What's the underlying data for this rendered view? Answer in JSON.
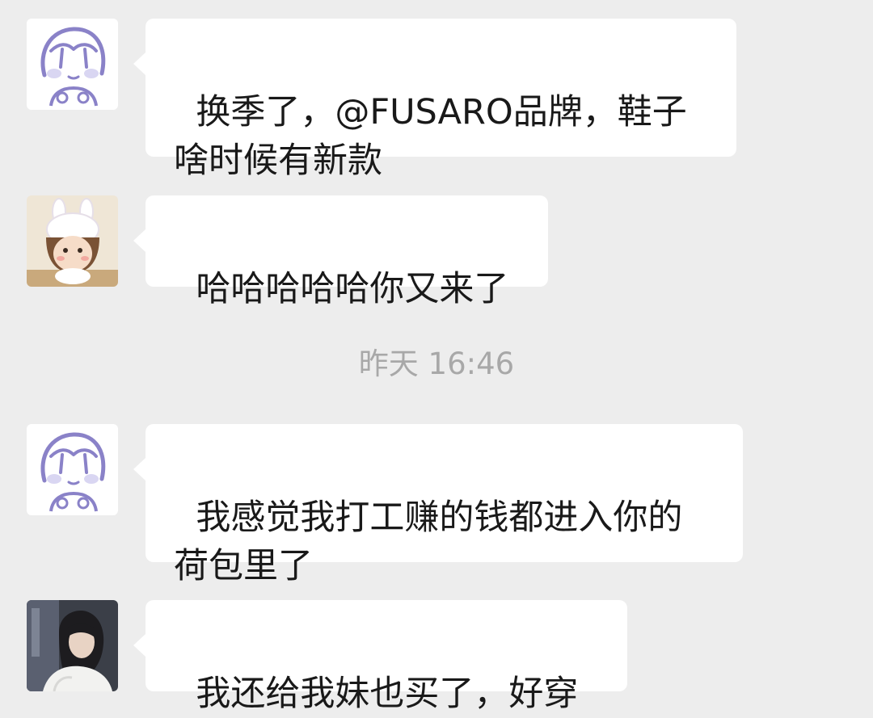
{
  "messages": [
    {
      "text": "换季了，@FUSARO品牌，鞋子\n啥时候有新款"
    },
    {
      "text": "哈哈哈哈哈你又来了"
    },
    {
      "text": "我感觉我打工赚的钱都进入你的\n荷包里了"
    },
    {
      "text": "我还给我妹也买了，好穿"
    }
  ],
  "timestamp": "昨天 16:46",
  "colors": {
    "background": "#ededed",
    "bubble": "#ffffff",
    "text": "#191919",
    "timestamp": "#a8a8a8"
  },
  "icons": [
    "girl-sketch-avatar-icon",
    "bunny-hat-girl-avatar-icon",
    "girl-sketch-avatar-icon",
    "woman-photo-avatar-icon"
  ]
}
